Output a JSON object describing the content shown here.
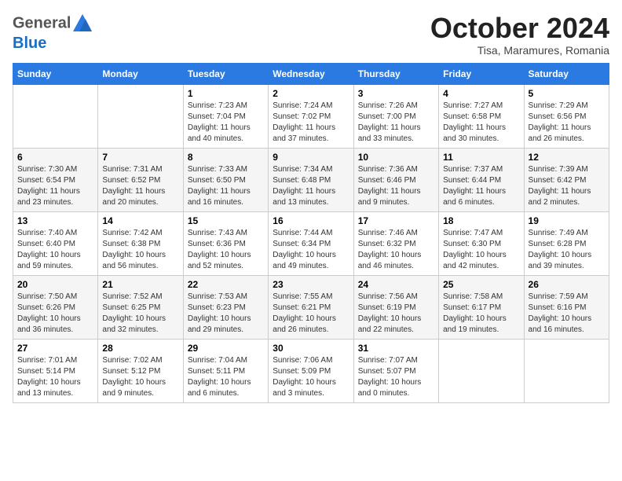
{
  "header": {
    "logo_line1": "General",
    "logo_line2": "Blue",
    "month_title": "October 2024",
    "location": "Tisa, Maramures, Romania"
  },
  "weekdays": [
    "Sunday",
    "Monday",
    "Tuesday",
    "Wednesday",
    "Thursday",
    "Friday",
    "Saturday"
  ],
  "weeks": [
    [
      {
        "day": "",
        "detail": ""
      },
      {
        "day": "",
        "detail": ""
      },
      {
        "day": "1",
        "detail": "Sunrise: 7:23 AM\nSunset: 7:04 PM\nDaylight: 11 hours and 40 minutes."
      },
      {
        "day": "2",
        "detail": "Sunrise: 7:24 AM\nSunset: 7:02 PM\nDaylight: 11 hours and 37 minutes."
      },
      {
        "day": "3",
        "detail": "Sunrise: 7:26 AM\nSunset: 7:00 PM\nDaylight: 11 hours and 33 minutes."
      },
      {
        "day": "4",
        "detail": "Sunrise: 7:27 AM\nSunset: 6:58 PM\nDaylight: 11 hours and 30 minutes."
      },
      {
        "day": "5",
        "detail": "Sunrise: 7:29 AM\nSunset: 6:56 PM\nDaylight: 11 hours and 26 minutes."
      }
    ],
    [
      {
        "day": "6",
        "detail": "Sunrise: 7:30 AM\nSunset: 6:54 PM\nDaylight: 11 hours and 23 minutes."
      },
      {
        "day": "7",
        "detail": "Sunrise: 7:31 AM\nSunset: 6:52 PM\nDaylight: 11 hours and 20 minutes."
      },
      {
        "day": "8",
        "detail": "Sunrise: 7:33 AM\nSunset: 6:50 PM\nDaylight: 11 hours and 16 minutes."
      },
      {
        "day": "9",
        "detail": "Sunrise: 7:34 AM\nSunset: 6:48 PM\nDaylight: 11 hours and 13 minutes."
      },
      {
        "day": "10",
        "detail": "Sunrise: 7:36 AM\nSunset: 6:46 PM\nDaylight: 11 hours and 9 minutes."
      },
      {
        "day": "11",
        "detail": "Sunrise: 7:37 AM\nSunset: 6:44 PM\nDaylight: 11 hours and 6 minutes."
      },
      {
        "day": "12",
        "detail": "Sunrise: 7:39 AM\nSunset: 6:42 PM\nDaylight: 11 hours and 2 minutes."
      }
    ],
    [
      {
        "day": "13",
        "detail": "Sunrise: 7:40 AM\nSunset: 6:40 PM\nDaylight: 10 hours and 59 minutes."
      },
      {
        "day": "14",
        "detail": "Sunrise: 7:42 AM\nSunset: 6:38 PM\nDaylight: 10 hours and 56 minutes."
      },
      {
        "day": "15",
        "detail": "Sunrise: 7:43 AM\nSunset: 6:36 PM\nDaylight: 10 hours and 52 minutes."
      },
      {
        "day": "16",
        "detail": "Sunrise: 7:44 AM\nSunset: 6:34 PM\nDaylight: 10 hours and 49 minutes."
      },
      {
        "day": "17",
        "detail": "Sunrise: 7:46 AM\nSunset: 6:32 PM\nDaylight: 10 hours and 46 minutes."
      },
      {
        "day": "18",
        "detail": "Sunrise: 7:47 AM\nSunset: 6:30 PM\nDaylight: 10 hours and 42 minutes."
      },
      {
        "day": "19",
        "detail": "Sunrise: 7:49 AM\nSunset: 6:28 PM\nDaylight: 10 hours and 39 minutes."
      }
    ],
    [
      {
        "day": "20",
        "detail": "Sunrise: 7:50 AM\nSunset: 6:26 PM\nDaylight: 10 hours and 36 minutes."
      },
      {
        "day": "21",
        "detail": "Sunrise: 7:52 AM\nSunset: 6:25 PM\nDaylight: 10 hours and 32 minutes."
      },
      {
        "day": "22",
        "detail": "Sunrise: 7:53 AM\nSunset: 6:23 PM\nDaylight: 10 hours and 29 minutes."
      },
      {
        "day": "23",
        "detail": "Sunrise: 7:55 AM\nSunset: 6:21 PM\nDaylight: 10 hours and 26 minutes."
      },
      {
        "day": "24",
        "detail": "Sunrise: 7:56 AM\nSunset: 6:19 PM\nDaylight: 10 hours and 22 minutes."
      },
      {
        "day": "25",
        "detail": "Sunrise: 7:58 AM\nSunset: 6:17 PM\nDaylight: 10 hours and 19 minutes."
      },
      {
        "day": "26",
        "detail": "Sunrise: 7:59 AM\nSunset: 6:16 PM\nDaylight: 10 hours and 16 minutes."
      }
    ],
    [
      {
        "day": "27",
        "detail": "Sunrise: 7:01 AM\nSunset: 5:14 PM\nDaylight: 10 hours and 13 minutes."
      },
      {
        "day": "28",
        "detail": "Sunrise: 7:02 AM\nSunset: 5:12 PM\nDaylight: 10 hours and 9 minutes."
      },
      {
        "day": "29",
        "detail": "Sunrise: 7:04 AM\nSunset: 5:11 PM\nDaylight: 10 hours and 6 minutes."
      },
      {
        "day": "30",
        "detail": "Sunrise: 7:06 AM\nSunset: 5:09 PM\nDaylight: 10 hours and 3 minutes."
      },
      {
        "day": "31",
        "detail": "Sunrise: 7:07 AM\nSunset: 5:07 PM\nDaylight: 10 hours and 0 minutes."
      },
      {
        "day": "",
        "detail": ""
      },
      {
        "day": "",
        "detail": ""
      }
    ]
  ]
}
